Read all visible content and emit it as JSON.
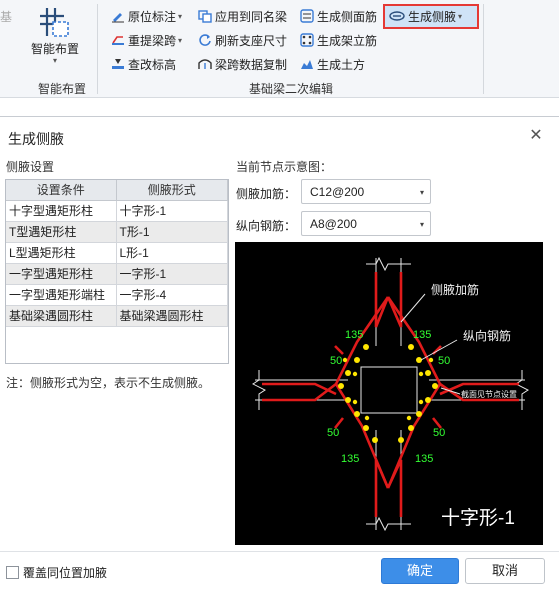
{
  "ribbon": {
    "cut_label": "基",
    "smart_layout": {
      "label": "智能布置",
      "group_title": "智能布置"
    },
    "edit_group_title": "基础梁二次编辑",
    "items": {
      "original_annotation": "原位标注",
      "apply_same_name": "应用到同名梁",
      "gen_side_rebar": "生成侧面筋",
      "gen_haunch": "生成侧腋",
      "reextract_span": "重提梁跨",
      "refresh_support": "刷新支座尺寸",
      "gen_stand_rebar": "生成架立筋",
      "check_elevation": "查改标高",
      "copy_span_data": "梁跨数据复制",
      "gen_earthwork": "生成土方"
    }
  },
  "dialog": {
    "title": "生成侧腋",
    "close_icon": "close-icon",
    "settings_label": "侧腋设置",
    "table": {
      "headers": [
        "设置条件",
        "侧腋形式"
      ],
      "rows": [
        [
          "十字型遇矩形柱",
          "十字形-1"
        ],
        [
          "T型遇矩形柱",
          "T形-1"
        ],
        [
          "L型遇矩形柱",
          "L形-1"
        ],
        [
          "一字型遇矩形柱",
          "一字形-1"
        ],
        [
          "一字型遇矩形端柱",
          "一字形-4"
        ],
        [
          "基础梁遇圆形柱",
          "基础梁遇圆形柱"
        ]
      ]
    },
    "note": "注：侧腋形式为空，表示不生成侧腋。",
    "preview_label": "当前节点示意图：",
    "haunch_rebar_label": "侧腋加筋：",
    "haunch_rebar_value": "C12@200",
    "long_rebar_label": "纵向钢筋：",
    "long_rebar_value": "A8@200",
    "diagram": {
      "callout_haunch": "侧腋加筋",
      "callout_long": "纵向钢筋",
      "callout_section": "截面见节点设置",
      "dim_135": "135",
      "dim_50": "50",
      "node_name": "十字形-1"
    },
    "overwrite_label": "覆盖同位置加腋",
    "ok_label": "确定",
    "cancel_label": "取消"
  }
}
